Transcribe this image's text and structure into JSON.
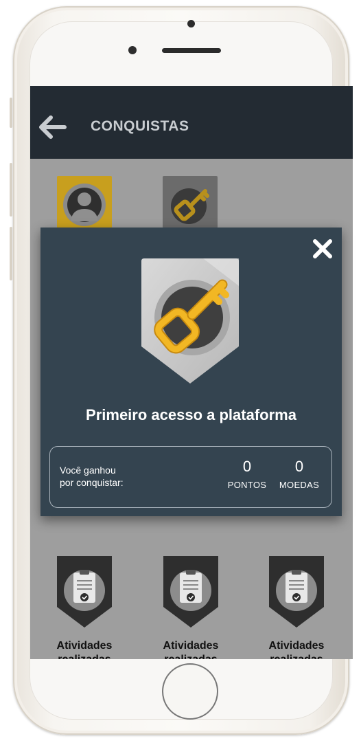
{
  "header": {
    "title": "CONQUISTAS"
  },
  "modal": {
    "title": "Primeiro acesso a plataforma",
    "reward_line1": "Você ganhou",
    "reward_line2": "por conquistar:",
    "points_value": "0",
    "points_label": "PONTOS",
    "coins_value": "0",
    "coins_label": "MOEDAS"
  },
  "achievements": [
    {
      "label_line1": "Atividades",
      "label_line2": "realizadas"
    },
    {
      "label_line1": "Atividades",
      "label_line2": "realizadas"
    },
    {
      "label_line1": "Atividades",
      "label_line2": "realizadas"
    }
  ],
  "icons": {
    "back": "arrow-left-icon",
    "close": "close-icon",
    "user_badge": "user-icon",
    "key_badge": "key-icon",
    "activity_badge": "clipboard-check-icon"
  },
  "colors": {
    "topbar": "#232b33",
    "modal": "#344450",
    "accent": "#f2b724",
    "screen_bg": "#9e9e9e"
  }
}
